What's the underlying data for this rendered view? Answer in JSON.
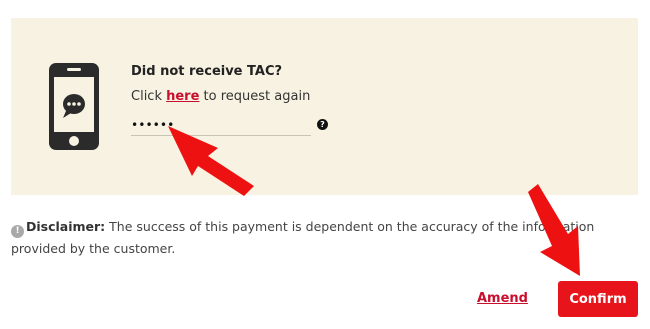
{
  "tac": {
    "title": "Did not receive TAC?",
    "request_prefix": "Click ",
    "request_link": "here",
    "request_suffix": " to request again",
    "input_value": "••••••",
    "help_icon": "question-circle-icon",
    "phone_icon": "smartphone-chat-icon"
  },
  "disclaimer": {
    "label": "Disclaimer:",
    "text": " The success of this payment is dependent on the accuracy of the information provided by the customer.",
    "icon": "info-icon"
  },
  "actions": {
    "amend_label": "Amend",
    "confirm_label": "Confirm"
  },
  "annotations": {
    "arrow_color": "#ee1111",
    "icon": "red-arrow"
  },
  "colors": {
    "panel_bg": "#f7f2e1",
    "accent_red": "#e8141c",
    "link_red": "#c8102e"
  }
}
